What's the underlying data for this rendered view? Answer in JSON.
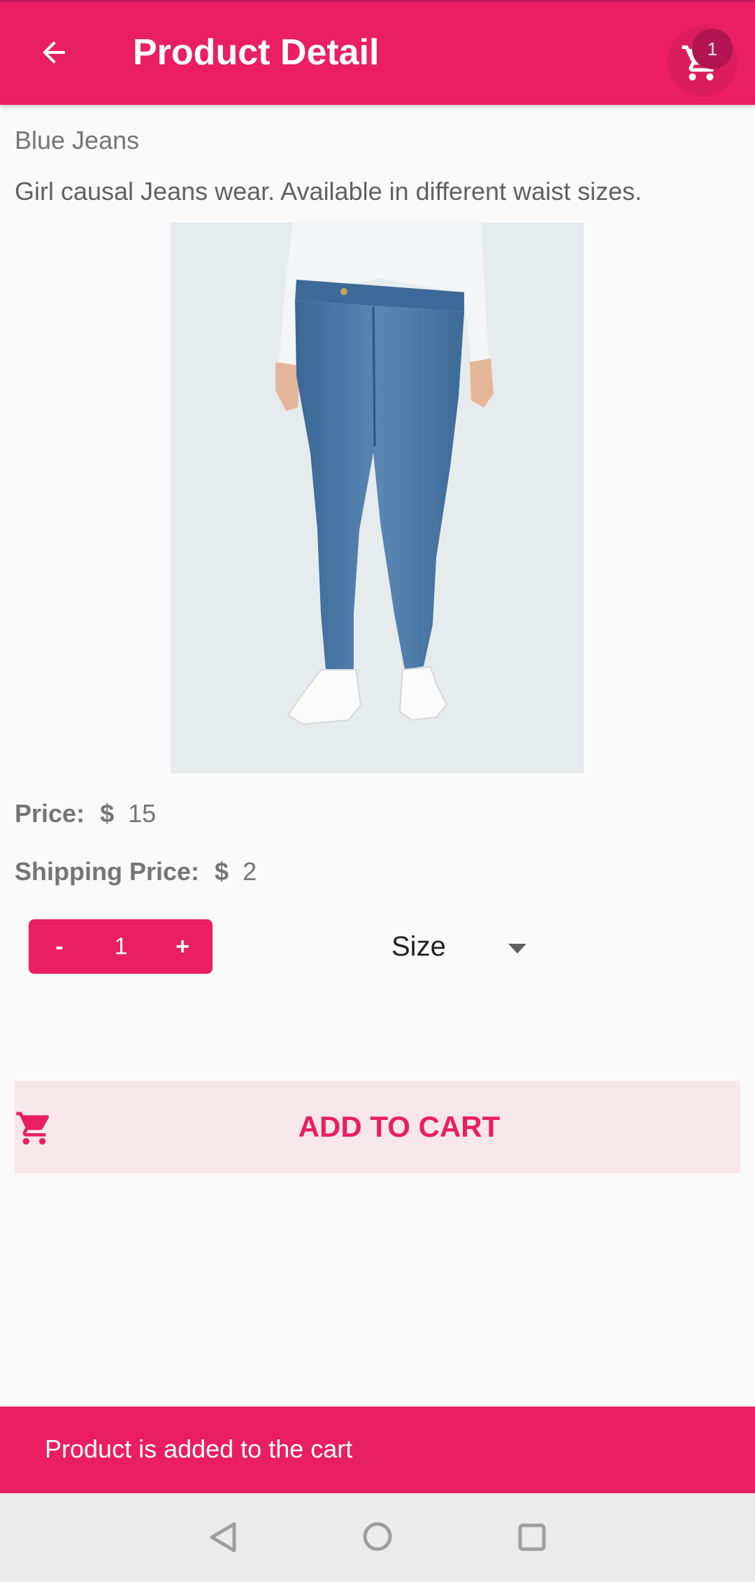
{
  "appbar": {
    "title": "Product Detail",
    "cart_badge": "1",
    "color": "#e91e63"
  },
  "product": {
    "name": "Blue Jeans",
    "description": "Girl causal Jeans wear. Available in different waist sizes.",
    "image_icon": "jeans-product-photo"
  },
  "pricing": {
    "price_label": "Price:",
    "price_currency": "$",
    "price_value": "15",
    "shipping_label": "Shipping Price:",
    "shipping_currency": "$",
    "shipping_value": "2"
  },
  "quantity": {
    "minus": "-",
    "value": "1",
    "plus": "+"
  },
  "size": {
    "label": "Size"
  },
  "actions": {
    "add_to_cart": "ADD TO CART"
  },
  "snackbar": {
    "message": "Product is added to the cart"
  },
  "navbar": {
    "icons": [
      "back-triangle-icon",
      "home-circle-icon",
      "recents-square-icon"
    ]
  }
}
